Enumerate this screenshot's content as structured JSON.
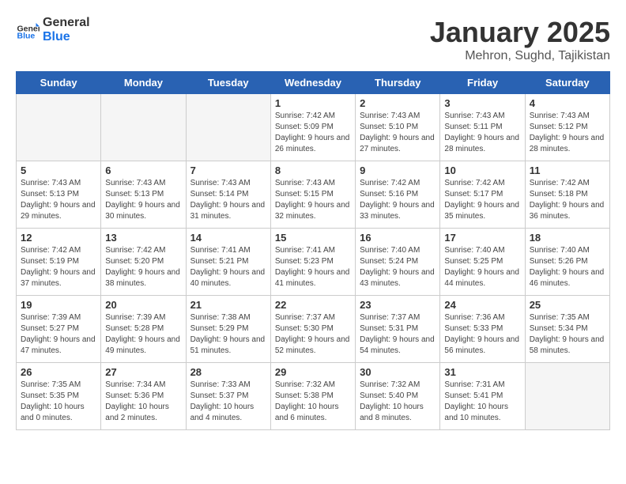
{
  "header": {
    "logo_general": "General",
    "logo_blue": "Blue",
    "title": "January 2025",
    "subtitle": "Mehron, Sughd, Tajikistan"
  },
  "weekdays": [
    "Sunday",
    "Monday",
    "Tuesday",
    "Wednesday",
    "Thursday",
    "Friday",
    "Saturday"
  ],
  "weeks": [
    [
      {
        "day": "",
        "empty": true
      },
      {
        "day": "",
        "empty": true
      },
      {
        "day": "",
        "empty": true
      },
      {
        "day": "1",
        "sunrise": "7:42 AM",
        "sunset": "5:09 PM",
        "daylight": "Daylight: 9 hours and 26 minutes."
      },
      {
        "day": "2",
        "sunrise": "7:43 AM",
        "sunset": "5:10 PM",
        "daylight": "Daylight: 9 hours and 27 minutes."
      },
      {
        "day": "3",
        "sunrise": "7:43 AM",
        "sunset": "5:11 PM",
        "daylight": "Daylight: 9 hours and 28 minutes."
      },
      {
        "day": "4",
        "sunrise": "7:43 AM",
        "sunset": "5:12 PM",
        "daylight": "Daylight: 9 hours and 28 minutes."
      }
    ],
    [
      {
        "day": "5",
        "sunrise": "7:43 AM",
        "sunset": "5:13 PM",
        "daylight": "Daylight: 9 hours and 29 minutes."
      },
      {
        "day": "6",
        "sunrise": "7:43 AM",
        "sunset": "5:13 PM",
        "daylight": "Daylight: 9 hours and 30 minutes."
      },
      {
        "day": "7",
        "sunrise": "7:43 AM",
        "sunset": "5:14 PM",
        "daylight": "Daylight: 9 hours and 31 minutes."
      },
      {
        "day": "8",
        "sunrise": "7:43 AM",
        "sunset": "5:15 PM",
        "daylight": "Daylight: 9 hours and 32 minutes."
      },
      {
        "day": "9",
        "sunrise": "7:42 AM",
        "sunset": "5:16 PM",
        "daylight": "Daylight: 9 hours and 33 minutes."
      },
      {
        "day": "10",
        "sunrise": "7:42 AM",
        "sunset": "5:17 PM",
        "daylight": "Daylight: 9 hours and 35 minutes."
      },
      {
        "day": "11",
        "sunrise": "7:42 AM",
        "sunset": "5:18 PM",
        "daylight": "Daylight: 9 hours and 36 minutes."
      }
    ],
    [
      {
        "day": "12",
        "sunrise": "7:42 AM",
        "sunset": "5:19 PM",
        "daylight": "Daylight: 9 hours and 37 minutes."
      },
      {
        "day": "13",
        "sunrise": "7:42 AM",
        "sunset": "5:20 PM",
        "daylight": "Daylight: 9 hours and 38 minutes."
      },
      {
        "day": "14",
        "sunrise": "7:41 AM",
        "sunset": "5:21 PM",
        "daylight": "Daylight: 9 hours and 40 minutes."
      },
      {
        "day": "15",
        "sunrise": "7:41 AM",
        "sunset": "5:23 PM",
        "daylight": "Daylight: 9 hours and 41 minutes."
      },
      {
        "day": "16",
        "sunrise": "7:40 AM",
        "sunset": "5:24 PM",
        "daylight": "Daylight: 9 hours and 43 minutes."
      },
      {
        "day": "17",
        "sunrise": "7:40 AM",
        "sunset": "5:25 PM",
        "daylight": "Daylight: 9 hours and 44 minutes."
      },
      {
        "day": "18",
        "sunrise": "7:40 AM",
        "sunset": "5:26 PM",
        "daylight": "Daylight: 9 hours and 46 minutes."
      }
    ],
    [
      {
        "day": "19",
        "sunrise": "7:39 AM",
        "sunset": "5:27 PM",
        "daylight": "Daylight: 9 hours and 47 minutes."
      },
      {
        "day": "20",
        "sunrise": "7:39 AM",
        "sunset": "5:28 PM",
        "daylight": "Daylight: 9 hours and 49 minutes."
      },
      {
        "day": "21",
        "sunrise": "7:38 AM",
        "sunset": "5:29 PM",
        "daylight": "Daylight: 9 hours and 51 minutes."
      },
      {
        "day": "22",
        "sunrise": "7:37 AM",
        "sunset": "5:30 PM",
        "daylight": "Daylight: 9 hours and 52 minutes."
      },
      {
        "day": "23",
        "sunrise": "7:37 AM",
        "sunset": "5:31 PM",
        "daylight": "Daylight: 9 hours and 54 minutes."
      },
      {
        "day": "24",
        "sunrise": "7:36 AM",
        "sunset": "5:33 PM",
        "daylight": "Daylight: 9 hours and 56 minutes."
      },
      {
        "day": "25",
        "sunrise": "7:35 AM",
        "sunset": "5:34 PM",
        "daylight": "Daylight: 9 hours and 58 minutes."
      }
    ],
    [
      {
        "day": "26",
        "sunrise": "7:35 AM",
        "sunset": "5:35 PM",
        "daylight": "Daylight: 10 hours and 0 minutes."
      },
      {
        "day": "27",
        "sunrise": "7:34 AM",
        "sunset": "5:36 PM",
        "daylight": "Daylight: 10 hours and 2 minutes."
      },
      {
        "day": "28",
        "sunrise": "7:33 AM",
        "sunset": "5:37 PM",
        "daylight": "Daylight: 10 hours and 4 minutes."
      },
      {
        "day": "29",
        "sunrise": "7:32 AM",
        "sunset": "5:38 PM",
        "daylight": "Daylight: 10 hours and 6 minutes."
      },
      {
        "day": "30",
        "sunrise": "7:32 AM",
        "sunset": "5:40 PM",
        "daylight": "Daylight: 10 hours and 8 minutes."
      },
      {
        "day": "31",
        "sunrise": "7:31 AM",
        "sunset": "5:41 PM",
        "daylight": "Daylight: 10 hours and 10 minutes."
      },
      {
        "day": "",
        "empty": true
      }
    ]
  ]
}
